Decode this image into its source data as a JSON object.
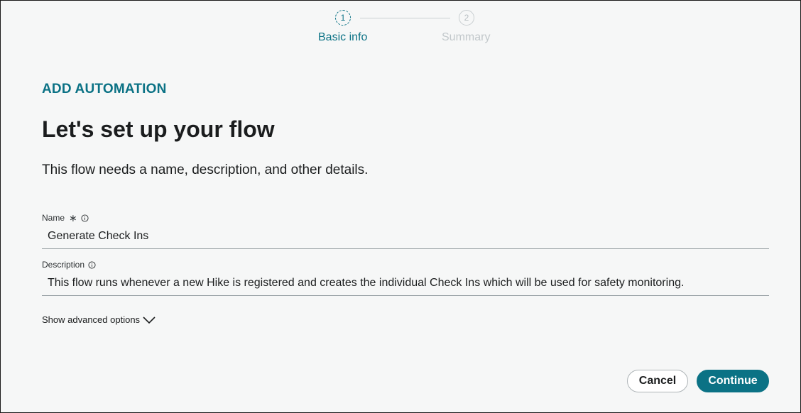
{
  "stepper": {
    "steps": [
      {
        "number": "1",
        "label": "Basic info",
        "state": "active"
      },
      {
        "number": "2",
        "label": "Summary",
        "state": "inactive"
      }
    ]
  },
  "header": {
    "eyebrow": "ADD AUTOMATION",
    "title": "Let's set up your flow",
    "subtitle": "This flow needs a name, description, and other details."
  },
  "form": {
    "name": {
      "label": "Name",
      "required_marker": "∗",
      "value": "Generate Check Ins",
      "icon": "info-icon"
    },
    "description": {
      "label": "Description",
      "value": "This flow runs whenever a new Hike is registered and creates the individual Check Ins which will be used for safety monitoring.",
      "icon": "info-icon"
    },
    "advanced_toggle": {
      "label": "Show advanced options",
      "icon": "chevron-down-icon"
    }
  },
  "actions": {
    "cancel_label": "Cancel",
    "continue_label": "Continue"
  },
  "colors": {
    "accent": "#0b7285",
    "background": "#f6f7f7",
    "text": "#1b1d1e",
    "inactive": "#c2c8cb"
  }
}
